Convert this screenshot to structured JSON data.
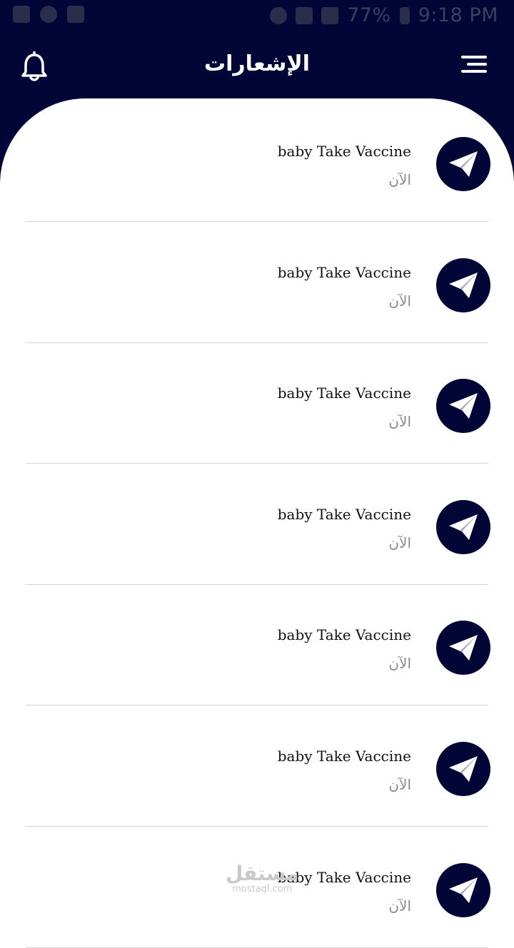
{
  "status_bar": {
    "battery": "77%",
    "time": "9:18 PM"
  },
  "header": {
    "title": "الإشعارات",
    "left_icon": "bell-icon",
    "right_icon": "menu-icon"
  },
  "notifications": [
    {
      "title": "baby Take Vaccine",
      "time": "الآن",
      "icon": "send-icon"
    },
    {
      "title": "baby Take Vaccine",
      "time": "الآن",
      "icon": "send-icon"
    },
    {
      "title": "baby Take Vaccine",
      "time": "الآن",
      "icon": "send-icon"
    },
    {
      "title": "baby Take Vaccine",
      "time": "الآن",
      "icon": "send-icon"
    },
    {
      "title": "baby Take Vaccine",
      "time": "الآن",
      "icon": "send-icon"
    },
    {
      "title": "baby Take Vaccine",
      "time": "الآن",
      "icon": "send-icon"
    },
    {
      "title": "baby Take Vaccine",
      "time": "الآن",
      "icon": "send-icon"
    }
  ],
  "watermark": {
    "arabic": "مستقل",
    "latin": "mostaql.com"
  },
  "colors": {
    "primary": "#020637",
    "background": "#ffffff",
    "divider": "#d4d4d4",
    "time_text": "#8a8a8a"
  }
}
